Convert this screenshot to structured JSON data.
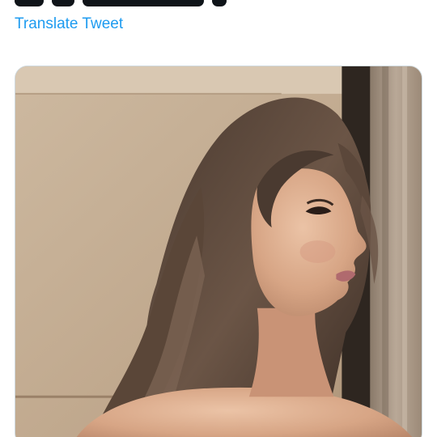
{
  "tweet": {
    "translate_label": "Translate Tweet"
  },
  "media": {
    "type": "photo",
    "subject": "portrait-photo"
  },
  "colors": {
    "link": "#1d9bf0",
    "text": "#0f1419",
    "border": "#cfd9de"
  }
}
